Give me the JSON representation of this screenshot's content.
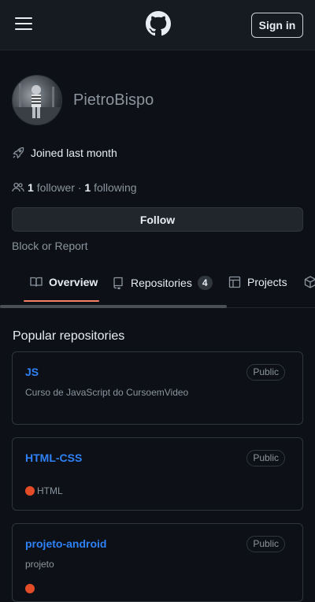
{
  "header": {
    "menu_icon": "hamburger-menu-icon",
    "logo_icon": "github-octocat-icon",
    "signin_label": "Sign in"
  },
  "profile": {
    "username": "PietroBispo",
    "joined": "Joined last month",
    "followers_count": "1",
    "followers_label": "follower",
    "separator": "·",
    "following_count": "1",
    "following_label": "following",
    "follow_button": "Follow",
    "block_report": "Block or Report"
  },
  "tabs": [
    {
      "label": "Overview",
      "icon": "book-icon",
      "active": true
    },
    {
      "label": "Repositories",
      "icon": "repo-icon",
      "count": "4"
    },
    {
      "label": "Projects",
      "icon": "table-icon"
    },
    {
      "label": "",
      "icon": "package-icon"
    }
  ],
  "popular": {
    "title": "Popular repositories",
    "repos": [
      {
        "name": "JS",
        "visibility": "Public",
        "description": "Curso de JavaScript do CursoemVideo",
        "language": ""
      },
      {
        "name": "HTML-CSS",
        "visibility": "Public",
        "description": "",
        "language": "HTML",
        "language_color": "#e34c26"
      },
      {
        "name": "projeto-android",
        "visibility": "Public",
        "description": "projeto",
        "language": ""
      }
    ]
  },
  "colors": {
    "background": "#0d1117",
    "header": "#161b22",
    "link": "#2f81f7",
    "active_tab_underline": "#f78166",
    "html_lang": "#e34c26"
  }
}
